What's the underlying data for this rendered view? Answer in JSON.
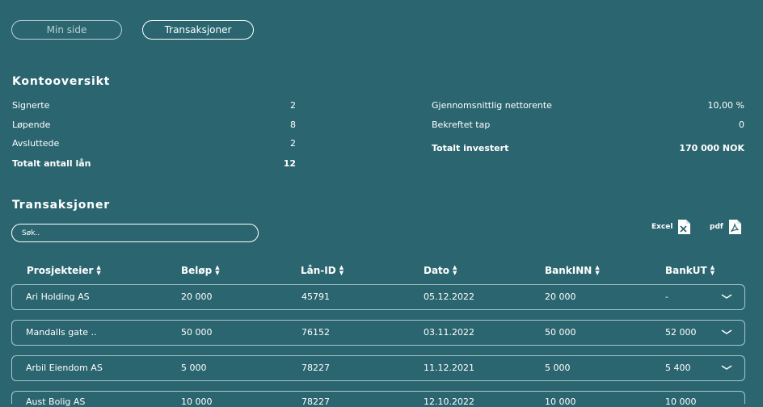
{
  "tabs": [
    {
      "label": "Min side",
      "active": false
    },
    {
      "label": "Transaksjoner",
      "active": true
    }
  ],
  "account_overview": {
    "title": "Kontooversikt",
    "left": [
      {
        "label": "Signerte",
        "value": "2"
      },
      {
        "label": "Løpende",
        "value": "8"
      },
      {
        "label": "Avsluttede",
        "value": "2"
      },
      {
        "label": "Totalt antall lån",
        "value": "12"
      }
    ],
    "right": [
      {
        "label": "Gjennomsnittlig nettorente",
        "value": "10,00 %"
      },
      {
        "label": "Bekreftet tap",
        "value": "0"
      },
      {
        "label": "Totalt investert",
        "value": "170 000 NOK"
      }
    ]
  },
  "transactions": {
    "title": "Transaksjoner",
    "search_placeholder": "Søk..",
    "excel_label": "Excel",
    "pdf_label": "pdf",
    "columns": [
      "Prosjekteier",
      "Beløp",
      "Lån-ID",
      "Dato",
      "BankINN",
      "BankUT"
    ],
    "rows": [
      [
        "Ari Holding AS",
        "20 000",
        "45791",
        "05.12.2022",
        "20 000",
        "-"
      ],
      [
        "Mandalls gate ..",
        "50 000",
        "76152",
        "03.11.2022",
        "50 000",
        "52 000"
      ],
      [
        "Arbil Eiendom AS",
        "5 000",
        "78227",
        "11.12.2021",
        "5 000",
        "5 400"
      ],
      [
        "Aust Bolig AS",
        "10 000",
        "78227",
        "12.10.2022",
        "10 000",
        "10 000"
      ]
    ]
  },
  "colors": {
    "background": "#2b6670",
    "text": "#ffffff",
    "row_border": "#a9c6ca"
  }
}
